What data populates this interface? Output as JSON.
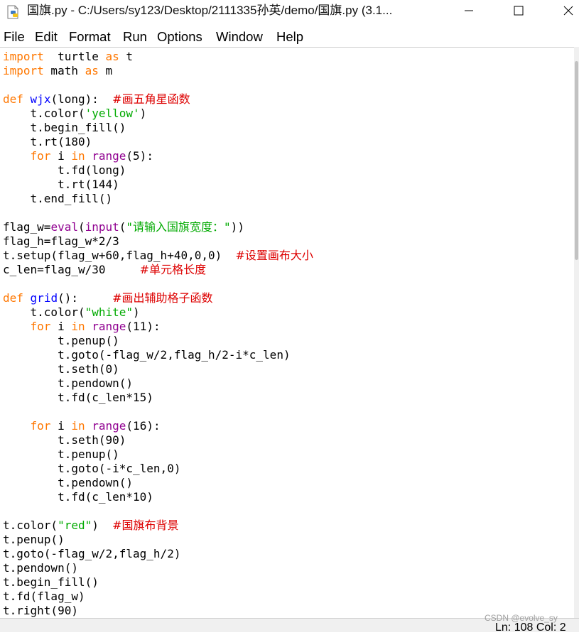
{
  "window": {
    "title": "国旗.py - C:/Users/sy123/Desktop/2111335孙英/demo/国旗.py (3.1..."
  },
  "menu": [
    "File",
    "Edit",
    "Format",
    "Run",
    "Options",
    "Window",
    "Help"
  ],
  "code_lines": [
    [
      [
        "kw",
        "import"
      ],
      [
        "",
        "  turtle "
      ],
      [
        "kw",
        "as"
      ],
      [
        "",
        " t"
      ]
    ],
    [
      [
        "kw",
        "import"
      ],
      [
        "",
        " math "
      ],
      [
        "kw",
        "as"
      ],
      [
        "",
        " m"
      ]
    ],
    [],
    [
      [
        "kw",
        "def"
      ],
      [
        "",
        " "
      ],
      [
        "df",
        "wjx"
      ],
      [
        "",
        "(long):  "
      ],
      [
        "cm",
        "#画五角星函数"
      ]
    ],
    [
      [
        "",
        "    t.color("
      ],
      [
        "str",
        "'yellow'"
      ],
      [
        "",
        ")"
      ]
    ],
    [
      [
        "",
        "    t.begin_fill()"
      ]
    ],
    [
      [
        "",
        "    t.rt(180)"
      ]
    ],
    [
      [
        "",
        "    "
      ],
      [
        "kw",
        "for"
      ],
      [
        "",
        " i "
      ],
      [
        "kw",
        "in"
      ],
      [
        "",
        " "
      ],
      [
        "bi",
        "range"
      ],
      [
        "",
        "(5):"
      ]
    ],
    [
      [
        "",
        "        t.fd(long)"
      ]
    ],
    [
      [
        "",
        "        t.rt(144)"
      ]
    ],
    [
      [
        "",
        "    t.end_fill()"
      ]
    ],
    [],
    [
      [
        "",
        "flag_w="
      ],
      [
        "bi",
        "eval"
      ],
      [
        "",
        "("
      ],
      [
        "bi",
        "input"
      ],
      [
        "",
        "("
      ],
      [
        "str",
        "\"请输入国旗宽度：\""
      ],
      [
        "",
        "))"
      ]
    ],
    [
      [
        "",
        "flag_h=flag_w*2/3"
      ]
    ],
    [
      [
        "",
        "t.setup(flag_w+60,flag_h+40,0,0)  "
      ],
      [
        "cm",
        "#设置画布大小"
      ]
    ],
    [
      [
        "",
        "c_len=flag_w/30     "
      ],
      [
        "cm",
        "#单元格长度"
      ]
    ],
    [],
    [
      [
        "kw",
        "def"
      ],
      [
        "",
        " "
      ],
      [
        "df",
        "grid"
      ],
      [
        "",
        "():     "
      ],
      [
        "cm",
        "#画出辅助格子函数"
      ]
    ],
    [
      [
        "",
        "    t.color("
      ],
      [
        "str",
        "\"white\""
      ],
      [
        "",
        ")"
      ]
    ],
    [
      [
        "",
        "    "
      ],
      [
        "kw",
        "for"
      ],
      [
        "",
        " i "
      ],
      [
        "kw",
        "in"
      ],
      [
        "",
        " "
      ],
      [
        "bi",
        "range"
      ],
      [
        "",
        "(11):"
      ]
    ],
    [
      [
        "",
        "        t.penup()"
      ]
    ],
    [
      [
        "",
        "        t.goto(-flag_w/2,flag_h/2-i*c_len)"
      ]
    ],
    [
      [
        "",
        "        t.seth(0)"
      ]
    ],
    [
      [
        "",
        "        t.pendown()"
      ]
    ],
    [
      [
        "",
        "        t.fd(c_len*15)"
      ]
    ],
    [],
    [
      [
        "",
        "    "
      ],
      [
        "kw",
        "for"
      ],
      [
        "",
        " i "
      ],
      [
        "kw",
        "in"
      ],
      [
        "",
        " "
      ],
      [
        "bi",
        "range"
      ],
      [
        "",
        "(16):"
      ]
    ],
    [
      [
        "",
        "        t.seth(90)"
      ]
    ],
    [
      [
        "",
        "        t.penup()"
      ]
    ],
    [
      [
        "",
        "        t.goto(-i*c_len,0)"
      ]
    ],
    [
      [
        "",
        "        t.pendown()"
      ]
    ],
    [
      [
        "",
        "        t.fd(c_len*10)"
      ]
    ],
    [],
    [
      [
        "",
        "t.color("
      ],
      [
        "str",
        "\"red\""
      ],
      [
        "",
        ")  "
      ],
      [
        "cm",
        "#国旗布背景"
      ]
    ],
    [
      [
        "",
        "t.penup()"
      ]
    ],
    [
      [
        "",
        "t.goto(-flag_w/2,flag_h/2)"
      ]
    ],
    [
      [
        "",
        "t.pendown()"
      ]
    ],
    [
      [
        "",
        "t.begin_fill()"
      ]
    ],
    [
      [
        "",
        "t.fd(flag_w)"
      ]
    ],
    [
      [
        "",
        "t.right(90)"
      ]
    ]
  ],
  "status": {
    "position": "Ln: 108   Col: 2"
  },
  "watermark": "CSDN @evolve_sy",
  "icons": {
    "app": "python-file-icon",
    "minimize": "minimize-icon",
    "maximize": "maximize-icon",
    "close": "close-icon"
  },
  "colors": {
    "keyword": "#ff7700",
    "builtin": "#900090",
    "string": "#00aa00",
    "comment": "#dd0000",
    "definition": "#0000ff"
  }
}
